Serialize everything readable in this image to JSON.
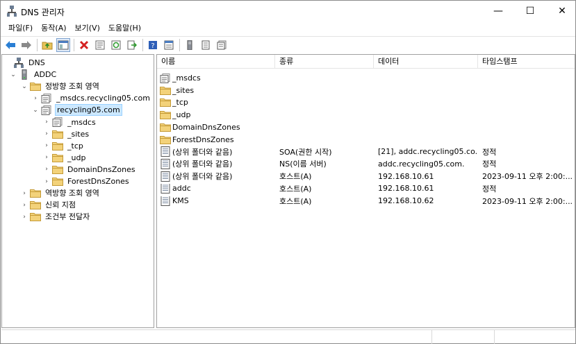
{
  "window": {
    "title": "DNS 관리자"
  },
  "controls": {
    "minimize": "—",
    "maximize": "☐",
    "close": "✕"
  },
  "menu": [
    "파일(F)",
    "동작(A)",
    "보기(V)",
    "도움말(H)"
  ],
  "tree": [
    {
      "label": "DNS",
      "expander": "",
      "icon": "dns-icon",
      "level": 0
    },
    {
      "label": "ADDC",
      "expander": "⌄",
      "icon": "server-icon",
      "level": 1
    },
    {
      "label": "정방향 조회 영역",
      "expander": "⌄",
      "icon": "folder-icon",
      "level": 2
    },
    {
      "label": "_msdcs.recycling05.com",
      "expander": "›",
      "icon": "zone-icon",
      "level": 3
    },
    {
      "label": "recycling05.com",
      "expander": "⌄",
      "icon": "zone-icon",
      "level": 3,
      "selected": true
    },
    {
      "label": "_msdcs",
      "expander": "›",
      "icon": "zone-icon",
      "level": 4
    },
    {
      "label": "_sites",
      "expander": "›",
      "icon": "folder-icon",
      "level": 4
    },
    {
      "label": "_tcp",
      "expander": "›",
      "icon": "folder-icon",
      "level": 4
    },
    {
      "label": "_udp",
      "expander": "›",
      "icon": "folder-icon",
      "level": 4
    },
    {
      "label": "DomainDnsZones",
      "expander": "›",
      "icon": "folder-icon",
      "level": 4
    },
    {
      "label": "ForestDnsZones",
      "expander": "›",
      "icon": "folder-icon",
      "level": 4
    },
    {
      "label": "역방향 조회 영역",
      "expander": "›",
      "icon": "folder-icon",
      "level": 2
    },
    {
      "label": "신뢰 지점",
      "expander": "›",
      "icon": "folder-icon",
      "level": 2
    },
    {
      "label": "조건부 전달자",
      "expander": "›",
      "icon": "folder-icon",
      "level": 2
    }
  ],
  "list": {
    "columns": [
      "이름",
      "종류",
      "데이터",
      "타임스탬프"
    ],
    "rows": [
      {
        "name": "_msdcs",
        "type": "",
        "data": "",
        "timestamp": "",
        "icon": "zone-icon"
      },
      {
        "name": "_sites",
        "type": "",
        "data": "",
        "timestamp": "",
        "icon": "folder-icon"
      },
      {
        "name": "_tcp",
        "type": "",
        "data": "",
        "timestamp": "",
        "icon": "folder-icon"
      },
      {
        "name": "_udp",
        "type": "",
        "data": "",
        "timestamp": "",
        "icon": "folder-icon"
      },
      {
        "name": "DomainDnsZones",
        "type": "",
        "data": "",
        "timestamp": "",
        "icon": "folder-icon"
      },
      {
        "name": "ForestDnsZones",
        "type": "",
        "data": "",
        "timestamp": "",
        "icon": "folder-icon"
      },
      {
        "name": "(상위 폴더와 같음)",
        "type": "SOA(권한 시작)",
        "data": "[21], addc.recycling05.co...",
        "timestamp": "정적",
        "icon": "record-icon"
      },
      {
        "name": "(상위 폴더와 같음)",
        "type": "NS(이름 서버)",
        "data": "addc.recycling05.com.",
        "timestamp": "정적",
        "icon": "record-icon"
      },
      {
        "name": "(상위 폴더와 같음)",
        "type": "호스트(A)",
        "data": "192.168.10.61",
        "timestamp": "2023-09-11 오후 2:00:...",
        "icon": "record-icon"
      },
      {
        "name": "addc",
        "type": "호스트(A)",
        "data": "192.168.10.61",
        "timestamp": "정적",
        "icon": "record-icon"
      },
      {
        "name": "KMS",
        "type": "호스트(A)",
        "data": "192.168.10.62",
        "timestamp": "2023-09-11 오후 2:00:...",
        "icon": "record-icon"
      }
    ]
  }
}
